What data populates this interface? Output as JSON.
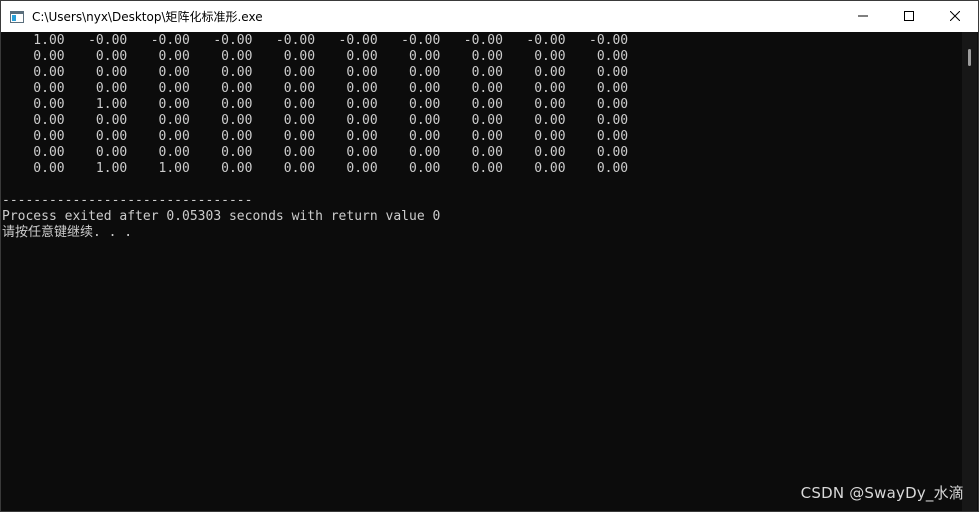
{
  "window": {
    "title": "C:\\Users\\nyx\\Desktop\\矩阵化标准形.exe",
    "icons": {
      "app": "console-app-icon",
      "minimize": "minimize-icon",
      "maximize": "maximize-icon",
      "close": "close-icon"
    }
  },
  "console": {
    "lines": [
      "    1.00   -0.00   -0.00   -0.00   -0.00   -0.00   -0.00   -0.00   -0.00   -0.00",
      "    0.00    0.00    0.00    0.00    0.00    0.00    0.00    0.00    0.00    0.00",
      "    0.00    0.00    0.00    0.00    0.00    0.00    0.00    0.00    0.00    0.00",
      "    0.00    0.00    0.00    0.00    0.00    0.00    0.00    0.00    0.00    0.00",
      "    0.00    1.00    0.00    0.00    0.00    0.00    0.00    0.00    0.00    0.00",
      "    0.00    0.00    0.00    0.00    0.00    0.00    0.00    0.00    0.00    0.00",
      "    0.00    0.00    0.00    0.00    0.00    0.00    0.00    0.00    0.00    0.00",
      "    0.00    0.00    0.00    0.00    0.00    0.00    0.00    0.00    0.00    0.00",
      "    0.00    1.00    1.00    0.00    0.00    0.00    0.00    0.00    0.00    0.00",
      "",
      "--------------------------------",
      "Process exited after 0.05303 seconds with return value 0",
      "请按任意键继续. . ."
    ]
  },
  "watermark": "CSDN @SwayDy_水滴",
  "colors": {
    "console_bg": "#0c0c0c",
    "console_text": "#cccccc",
    "titlebar_bg": "#ffffff"
  }
}
